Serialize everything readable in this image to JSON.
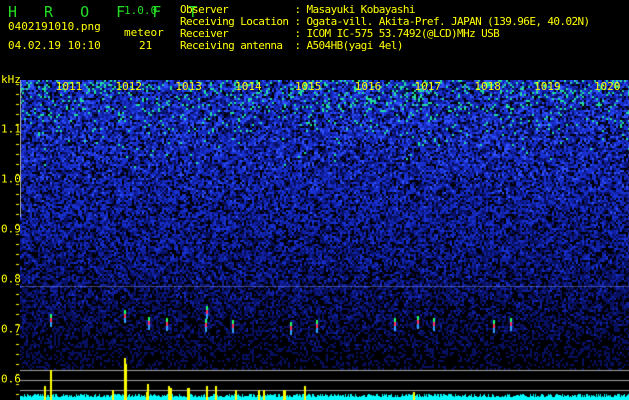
{
  "header": {
    "app_name": "H R O F F T",
    "version": "1.0.0",
    "filename": "0402191010.png",
    "datetime": "04.02.19 10:10",
    "meteor_label": "meteor",
    "meteor_count": "21"
  },
  "info": [
    {
      "label": "Observer          ",
      "value": ": Masayuki Kobayashi"
    },
    {
      "label": "Receiving Location",
      "value": ": Ogata-vill. Akita-Pref. JAPAN (139.96E, 40.02N)"
    },
    {
      "label": "Receiver          ",
      "value": ": ICOM IC-575 53.7492(@LCD)MHz USB"
    },
    {
      "label": "Receiving antenna ",
      "value": ": A504HB(yagi 4el)"
    }
  ],
  "axis": {
    "unit": "kHz",
    "y_ticks": [
      "1.1",
      "1.0",
      "0.9",
      "0.8",
      "0.7",
      "0.6"
    ],
    "y_values": [
      1.1,
      1.0,
      0.9,
      0.8,
      0.7,
      0.6
    ],
    "y_range": [
      0.55,
      1.19
    ],
    "time_labels": [
      "1011",
      "1012",
      "1013",
      "1014",
      "1015",
      "1016",
      "1017",
      "1018",
      "1019",
      "1020"
    ]
  },
  "colors": {
    "text": "#ffff00",
    "logo": "#22dd22",
    "baseline": "#00ffff",
    "spike": "#ffff00",
    "grid": "#a0a0a0"
  }
}
